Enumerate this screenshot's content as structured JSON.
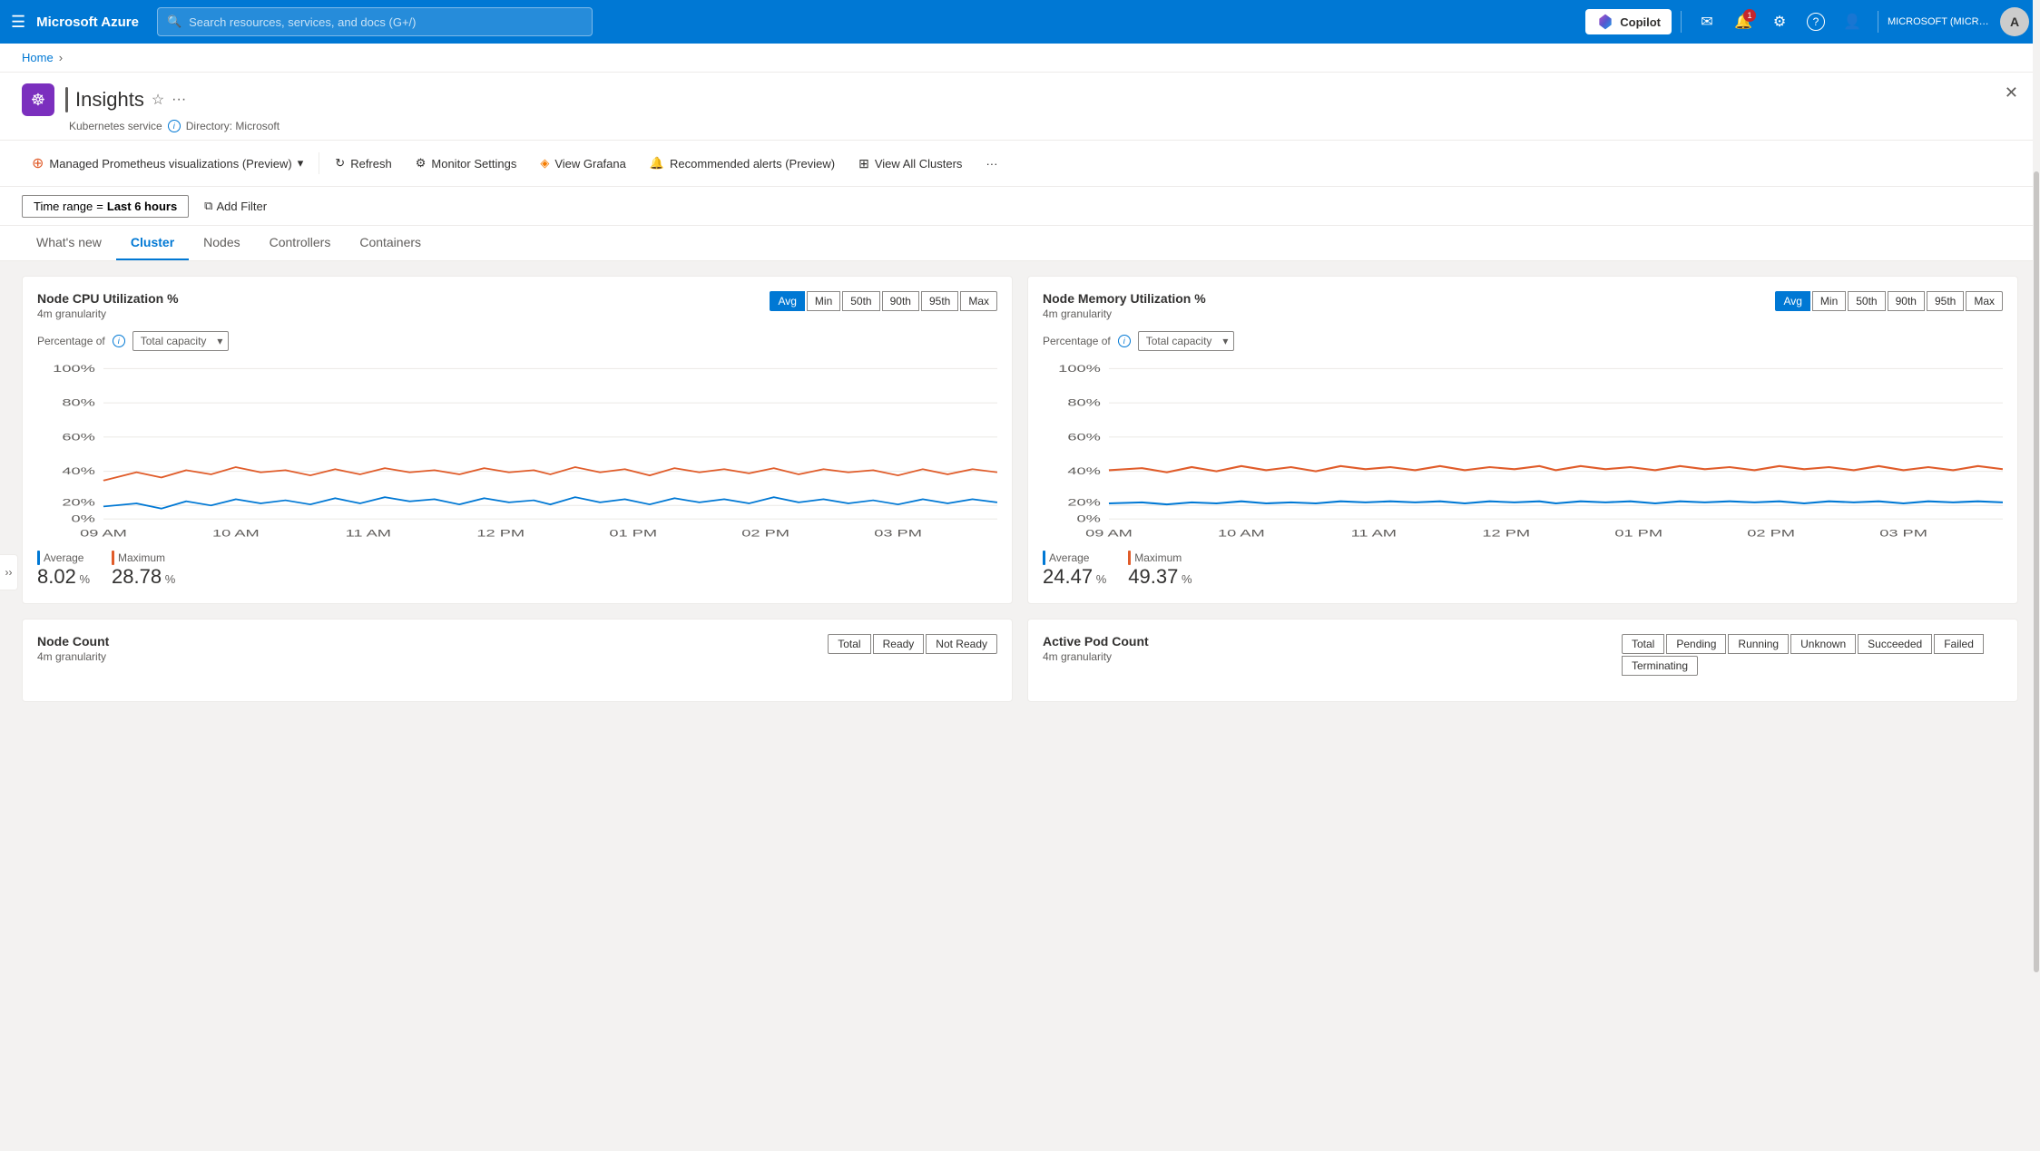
{
  "topbar": {
    "hamburger_label": "☰",
    "brand": "Microsoft Azure",
    "search_placeholder": "Search resources, services, and docs (G+/)",
    "copilot_label": "Copilot",
    "notification_count": "1",
    "user_account": "MICROSOFT (MICROSOFT.ONMI...)",
    "icons": {
      "feedback": "✉",
      "notifications": "🔔",
      "settings": "⚙",
      "help": "?",
      "cloud": "🌐"
    }
  },
  "breadcrumb": {
    "home_label": "Home",
    "chevron": "›"
  },
  "resource": {
    "title": "Insights",
    "subtitle_type": "Kubernetes service",
    "subtitle_directory": "Directory: Microsoft",
    "close_label": "✕"
  },
  "toolbar": {
    "managed_prometheus": "Managed Prometheus visualizations (Preview)",
    "refresh_label": "Refresh",
    "monitor_settings_label": "Monitor Settings",
    "view_grafana_label": "View Grafana",
    "recommended_alerts_label": "Recommended alerts (Preview)",
    "view_all_clusters_label": "View All Clusters",
    "more_label": "···"
  },
  "filter_bar": {
    "time_range_label": "Time range",
    "time_range_value": "Last 6 hours",
    "add_filter_label": "Add Filter"
  },
  "tabs": [
    {
      "id": "whats-new",
      "label": "What's new",
      "active": false
    },
    {
      "id": "cluster",
      "label": "Cluster",
      "active": true
    },
    {
      "id": "nodes",
      "label": "Nodes",
      "active": false
    },
    {
      "id": "controllers",
      "label": "Controllers",
      "active": false
    },
    {
      "id": "containers",
      "label": "Containers",
      "active": false
    }
  ],
  "cpu_chart": {
    "title": "Node CPU Utilization %",
    "granularity": "4m granularity",
    "stat_buttons": [
      "Avg",
      "Min",
      "50th",
      "90th",
      "95th",
      "Max"
    ],
    "active_stat": "Avg",
    "filter_label": "Percentage of",
    "capacity_label": "Total capacity",
    "y_labels": [
      "100%",
      "80%",
      "60%",
      "40%",
      "20%",
      "0%"
    ],
    "x_labels": [
      "09 AM",
      "10 AM",
      "11 AM",
      "12 PM",
      "01 PM",
      "02 PM",
      "03 PM"
    ],
    "metric_average_label": "Average",
    "metric_average_value": "8.02",
    "metric_average_unit": "%",
    "metric_maximum_label": "Maximum",
    "metric_maximum_value": "28.78",
    "metric_maximum_unit": "%",
    "avg_color": "#0078d4",
    "max_color": "#e05c2a"
  },
  "memory_chart": {
    "title": "Node Memory Utilization %",
    "granularity": "4m granularity",
    "stat_buttons": [
      "Avg",
      "Min",
      "50th",
      "90th",
      "95th",
      "Max"
    ],
    "active_stat": "Avg",
    "filter_label": "Percentage of",
    "capacity_label": "Total capacity",
    "y_labels": [
      "100%",
      "80%",
      "60%",
      "40%",
      "20%",
      "0%"
    ],
    "x_labels": [
      "09 AM",
      "10 AM",
      "11 AM",
      "12 PM",
      "01 PM",
      "02 PM",
      "03 PM"
    ],
    "metric_average_label": "Average",
    "metric_average_value": "24.47",
    "metric_average_unit": "%",
    "metric_maximum_label": "Maximum",
    "metric_maximum_value": "49.37",
    "metric_maximum_unit": "%",
    "avg_color": "#0078d4",
    "max_color": "#e05c2a"
  },
  "node_count_chart": {
    "title": "Node Count",
    "granularity": "4m granularity",
    "btn_total": "Total",
    "btn_ready": "Ready",
    "btn_not_ready": "Not Ready"
  },
  "pod_count_chart": {
    "title": "Active Pod Count",
    "granularity": "4m granularity",
    "btn_labels": [
      "Total",
      "Pending",
      "Running",
      "Unknown",
      "Succeeded",
      "Failed",
      "Terminating"
    ]
  }
}
